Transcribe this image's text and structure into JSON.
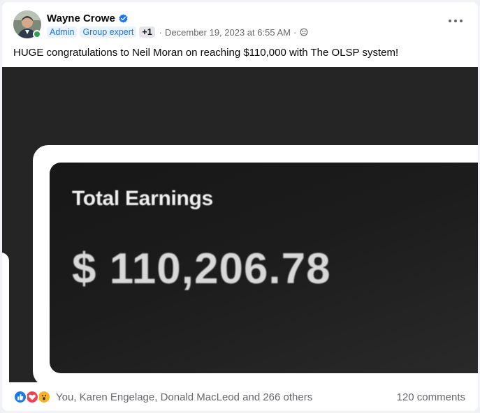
{
  "post": {
    "author": "Wayne Crowe",
    "badges": [
      "Admin",
      "Group expert",
      "+1"
    ],
    "timestamp": "December 19, 2023 at 6:55 AM",
    "separator": "·",
    "audience_icon": "globe-icon",
    "text": "HUGE congratulations to Neil Moran on reaching $110,000 with The OLSP system!"
  },
  "photo": {
    "label": "Total Earnings",
    "amount": "$ 110,206.78"
  },
  "footer": {
    "reactions": [
      "like-reaction-icon",
      "love-reaction-icon",
      "wow-reaction-icon"
    ],
    "reaction_summary": "You, Karen Engelage, Donald MacLeod and 266 others",
    "comments": "120 comments"
  },
  "colors": {
    "accent": "#1877f2",
    "badge_bg": "#e7f3ff",
    "badge_text": "#1b74e4",
    "online": "#31a24c",
    "photo_bg": "#252525"
  }
}
